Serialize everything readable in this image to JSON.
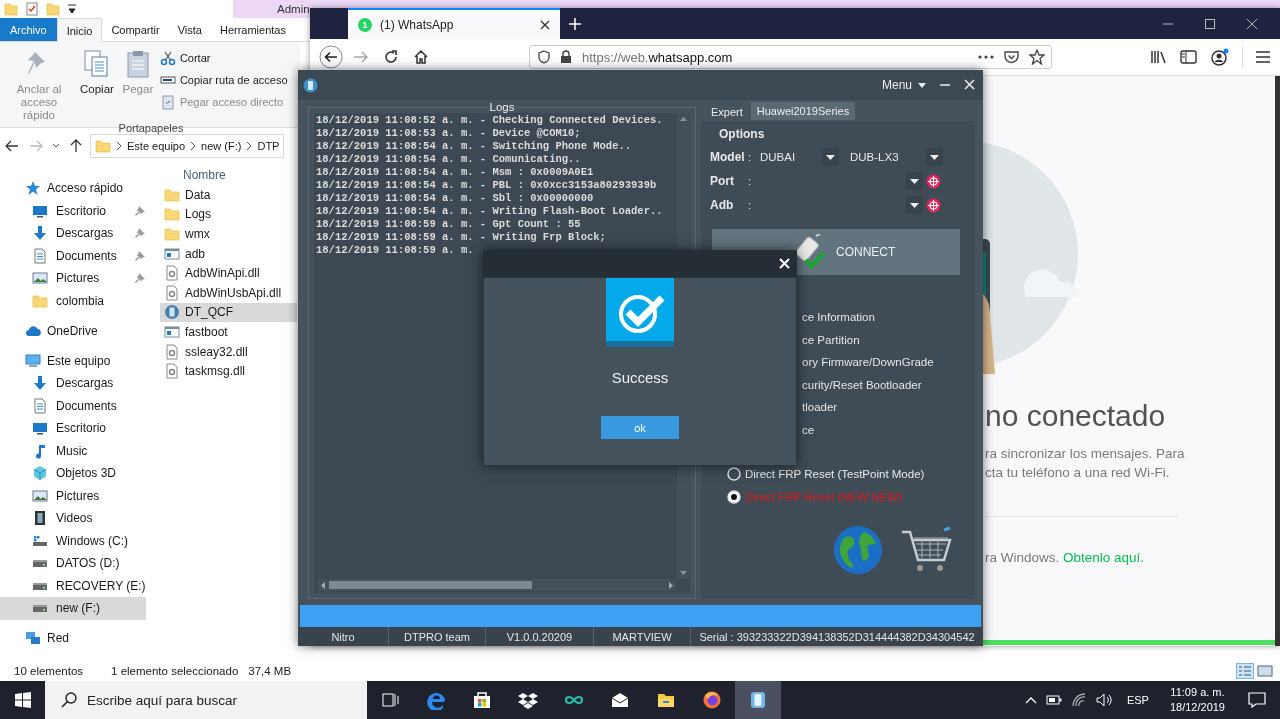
{
  "explorer": {
    "title": "Admin",
    "ribbon_tabs": [
      {
        "label": "Archivo",
        "kind": "file-menu",
        "selected": false
      },
      {
        "label": "Inicio",
        "kind": "tab",
        "selected": true
      },
      {
        "label": "Compartir",
        "kind": "tab",
        "selected": false
      },
      {
        "label": "Vista",
        "kind": "tab",
        "selected": false
      },
      {
        "label": "Herramientas",
        "kind": "tab",
        "selected": false
      }
    ],
    "ribbon_group": {
      "label": "Portapapeles",
      "large_commands": [
        {
          "label": "Anclar al acceso rápido",
          "kind": "pin",
          "disabled": true
        },
        {
          "label": "Copiar",
          "kind": "copy",
          "disabled": false
        },
        {
          "label": "Pegar",
          "kind": "paste",
          "disabled": true
        }
      ],
      "small_commands": [
        {
          "label": "Cortar",
          "kind": "cut",
          "disabled": false
        },
        {
          "label": "Copiar ruta de acceso",
          "kind": "copy-path",
          "disabled": false
        },
        {
          "label": "Pegar acceso directo",
          "kind": "paste-shortcut",
          "disabled": true
        }
      ]
    },
    "breadcrumb": [
      "Este equipo",
      "new (F:)",
      "DTP"
    ],
    "nav_tree": [
      {
        "label": "Acceso rápido",
        "kind": "star",
        "selected": false,
        "children": [
          {
            "label": "Escritorio",
            "kind": "desktop",
            "pinned": true,
            "selected": false
          },
          {
            "label": "Descargas",
            "kind": "download",
            "pinned": true,
            "selected": false
          },
          {
            "label": "Documents",
            "kind": "document",
            "pinned": true,
            "selected": false
          },
          {
            "label": "Pictures",
            "kind": "pictures",
            "pinned": true,
            "selected": false
          },
          {
            "label": "colombia",
            "kind": "folder",
            "pinned": false,
            "selected": false
          }
        ]
      },
      {
        "label": "OneDrive",
        "kind": "cloud",
        "selected": false
      },
      {
        "label": "Este equipo",
        "kind": "computer",
        "selected": false,
        "children": [
          {
            "label": "Descargas",
            "kind": "download",
            "selected": false
          },
          {
            "label": "Documents",
            "kind": "document",
            "selected": false
          },
          {
            "label": "Escritorio",
            "kind": "desktop",
            "selected": false
          },
          {
            "label": "Music",
            "kind": "music",
            "selected": false
          },
          {
            "label": "Objetos 3D",
            "kind": "cube",
            "selected": false
          },
          {
            "label": "Pictures",
            "kind": "pictures",
            "selected": false
          },
          {
            "label": "Videos",
            "kind": "video",
            "selected": false
          },
          {
            "label": "Windows (C:)",
            "kind": "drive-windows",
            "selected": false
          },
          {
            "label": "DATOS (D:)",
            "kind": "drive",
            "selected": false
          },
          {
            "label": "RECOVERY (E:)",
            "kind": "drive",
            "selected": false
          },
          {
            "label": "new (F:)",
            "kind": "drive",
            "selected": true
          }
        ]
      },
      {
        "label": "Red",
        "kind": "network",
        "selected": false
      }
    ],
    "column_header": "Nombre",
    "files": [
      {
        "name": "Data",
        "kind": "folder",
        "selected": false
      },
      {
        "name": "Logs",
        "kind": "folder",
        "selected": false
      },
      {
        "name": "wmx",
        "kind": "folder",
        "selected": false
      },
      {
        "name": "adb",
        "kind": "exe",
        "selected": false
      },
      {
        "name": "AdbWinApi.dll",
        "kind": "dll",
        "selected": false
      },
      {
        "name": "AdbWinUsbApi.dll",
        "kind": "dll",
        "selected": false
      },
      {
        "name": "DT_QCF",
        "kind": "app",
        "selected": true
      },
      {
        "name": "fastboot",
        "kind": "exe",
        "selected": false
      },
      {
        "name": "ssleay32.dll",
        "kind": "dll",
        "selected": false
      },
      {
        "name": "taskmsg.dll",
        "kind": "dll",
        "selected": false
      }
    ],
    "status_bar": {
      "item_count": "10 elementos",
      "selection_info": "1 elemento seleccionado",
      "selection_size": "37,4 MB"
    }
  },
  "browser": {
    "tab": {
      "badge": "1",
      "title": "(1) WhatsApp"
    },
    "address": {
      "prefix": "https://web.",
      "domain": "whatsapp.com"
    },
    "page": {
      "heading": "no conectado",
      "message_lines": [
        "ra sincronizar los mensajes. Para",
        "cta tu teléfono a una red Wi-Fi."
      ],
      "footer_text": "ra Windows.",
      "footer_link": "Obtenlo aquí."
    }
  },
  "tool": {
    "menu": "Menu",
    "logs": {
      "title": "Logs",
      "lines": [
        "18/12/2019 11:08:52 a. m. - Checking Connected Devices.",
        "18/12/2019 11:08:53 a. m. - Device @COM10;",
        "18/12/2019 11:08:54 a. m. - Switching Phone Mode..",
        "18/12/2019 11:08:54 a. m. - Comunicating..",
        "18/12/2019 11:08:54 a. m. - Msm : 0x0009A0E1",
        "18/12/2019 11:08:54 a. m. - PBL : 0x0xcc3153a80293939b",
        "18/12/2019 11:08:54 a. m. - Sbl : 0x00000000",
        "18/12/2019 11:08:54 a. m. - Writing Flash-Boot Loader..",
        "18/12/2019 11:08:59 a. m. - Gpt Count : 55",
        "18/12/2019 11:08:59 a. m. - Writing Frp Block;",
        "18/12/2019 11:08:59 a. m."
      ]
    },
    "tabs": [
      {
        "label": "Expert",
        "selected": false
      },
      {
        "label": "Huawei2019Series",
        "selected": true
      }
    ],
    "options_title": "Options",
    "fields": [
      {
        "kind": "model",
        "label": "Model",
        "separator": ":",
        "value": "DUBAI",
        "variant": "DUB-LX3"
      },
      {
        "kind": "port",
        "label": "Port",
        "separator": ":"
      },
      {
        "kind": "adb",
        "label": "Adb",
        "separator": ":"
      }
    ],
    "connect": "CONNECT",
    "operations": [
      "ce Information",
      "ce Partition",
      "ory Firmware/DownGrade",
      "curity/Reset Bootloader",
      "tloader",
      "ce"
    ],
    "frp_options": [
      {
        "label": "Direct FRP Reset (TestPoint Mode)",
        "selected": false
      },
      {
        "label": "Direct FRP Reset (NEW NEW)",
        "selected": true
      }
    ],
    "progress": {
      "level": 1
    },
    "status_bar": [
      "Nitro",
      "DTPRO team",
      "V1.0.0.20209",
      "MARTVIEW",
      "Serial : 393233322D394138352D314444382D34304542"
    ]
  },
  "dialog": {
    "message": "Success",
    "button": "ok"
  },
  "taskbar": {
    "search_placeholder": "Escribe aquí para buscar",
    "apps": [
      {
        "kind": "task-view",
        "active": false
      },
      {
        "kind": "edge",
        "active": false
      },
      {
        "kind": "store",
        "active": false
      },
      {
        "kind": "dropbox",
        "active": false
      },
      {
        "kind": "infinity",
        "active": false
      },
      {
        "kind": "mail",
        "active": false
      },
      {
        "kind": "file-explorer",
        "active": false
      },
      {
        "kind": "firefox",
        "active": false
      },
      {
        "kind": "phone-tool",
        "active": true
      }
    ],
    "language": "ESP",
    "time": "11:09 a. m.",
    "date": "18/12/2019"
  }
}
